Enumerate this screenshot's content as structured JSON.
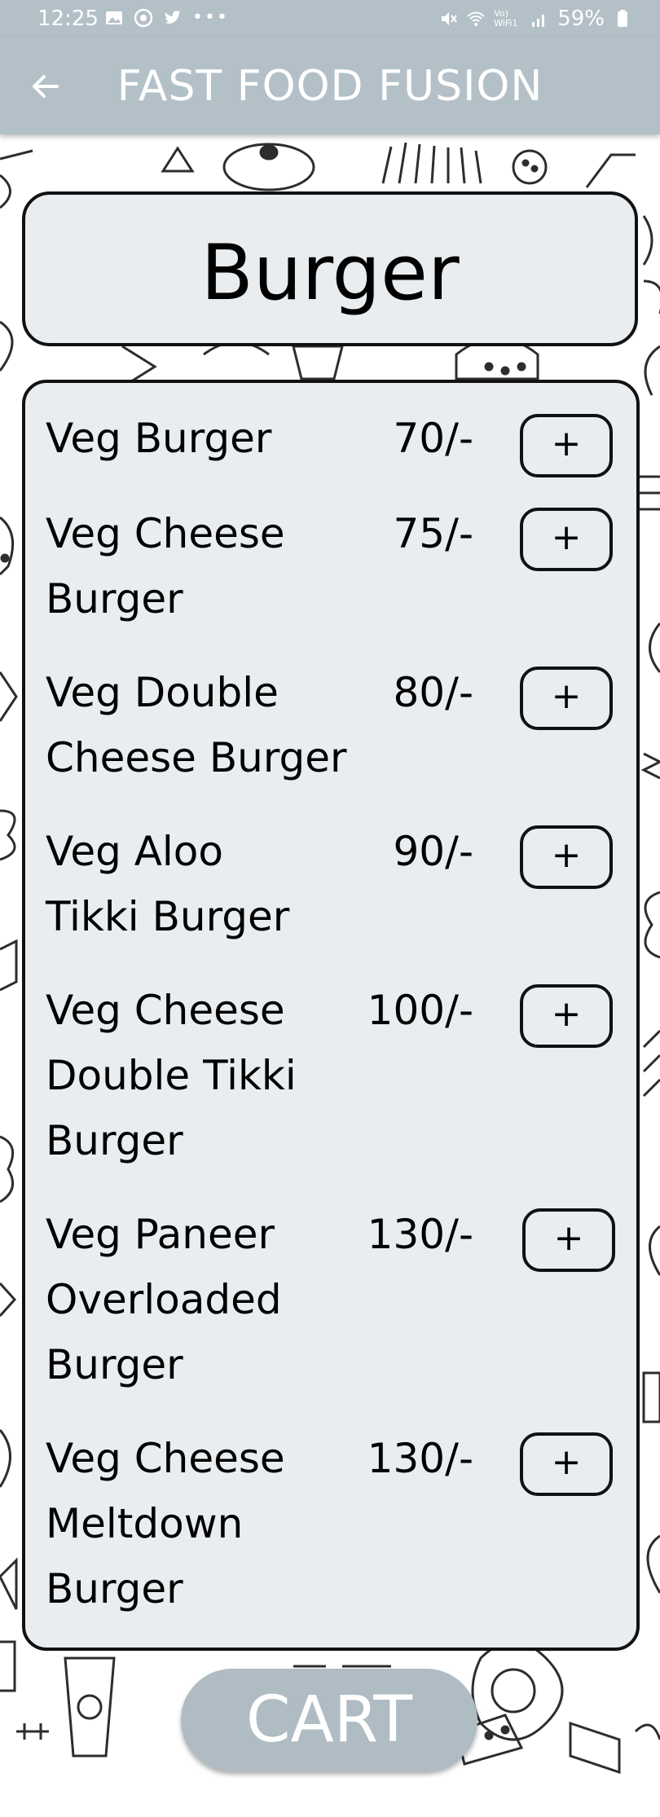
{
  "status_bar": {
    "time": "12:25",
    "battery": "59%",
    "left_icons": [
      "gallery-icon",
      "whatsapp-icon",
      "twitter-icon",
      "more-dots-icon"
    ],
    "right_icons": [
      "mute-icon",
      "wifi-icon",
      "signal-icon",
      "battery-icon"
    ],
    "wifi_label": "Vo) WiFi1"
  },
  "app_bar": {
    "title": "FAST FOOD FUSION",
    "back_icon": "arrow-left-icon"
  },
  "category": {
    "title": "Burger"
  },
  "menu": {
    "add_label": "+",
    "items": [
      {
        "name": "Veg Burger",
        "price": "70/-"
      },
      {
        "name": "Veg Cheese Burger",
        "price": "75/-"
      },
      {
        "name": "Veg Double Cheese Burger",
        "price": "80/-"
      },
      {
        "name": "Veg Aloo Tikki Burger",
        "price": "90/-"
      },
      {
        "name": "Veg Cheese Double Tikki Burger",
        "price": "100/-"
      },
      {
        "name": "Veg Paneer Overloaded Burger",
        "price": "130/-"
      },
      {
        "name": "Veg Cheese Meltdown Burger",
        "price": "130/-"
      }
    ]
  },
  "cart": {
    "label": "CART"
  },
  "colors": {
    "app_bar": "#b3c0c8",
    "card_bg": "#e9edf0",
    "border": "#111111",
    "cart_button": "#afbcc4"
  }
}
